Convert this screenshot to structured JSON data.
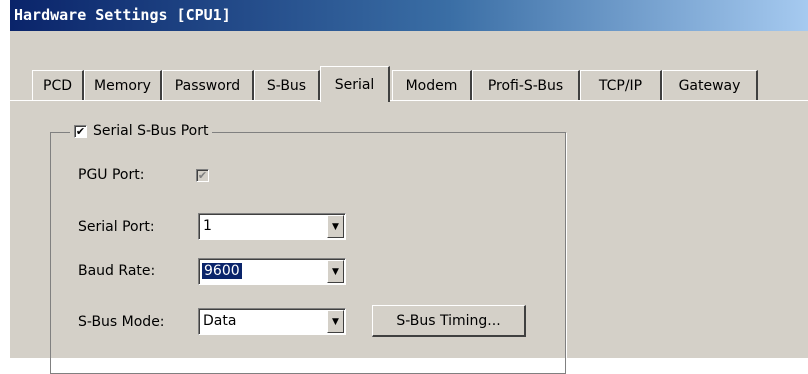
{
  "window": {
    "title": "Hardware Settings [CPU1]"
  },
  "tabs": [
    {
      "label": "PCD",
      "active": false
    },
    {
      "label": "Memory",
      "active": false
    },
    {
      "label": "Password",
      "active": false
    },
    {
      "label": "S-Bus",
      "active": false
    },
    {
      "label": "Serial",
      "active": true
    },
    {
      "label": "Modem",
      "active": false
    },
    {
      "label": "Profi-S-Bus",
      "active": false
    },
    {
      "label": "TCP/IP",
      "active": false
    },
    {
      "label": "Gateway",
      "active": false
    }
  ],
  "group": {
    "label": "Serial S-Bus Port",
    "checked": true,
    "check_glyph": "✔"
  },
  "fields": {
    "pgu_port": {
      "label": "PGU Port:",
      "checked": true,
      "disabled": true
    },
    "serial_port": {
      "label": "Serial Port:",
      "value": "1"
    },
    "baud_rate": {
      "label": "Baud Rate:",
      "value": "9600"
    },
    "sbus_mode": {
      "label": "S-Bus Mode:",
      "value": "Data"
    }
  },
  "buttons": {
    "sbus_timing": "S-Bus Timing..."
  },
  "icons": {
    "dropdown": "▼"
  }
}
